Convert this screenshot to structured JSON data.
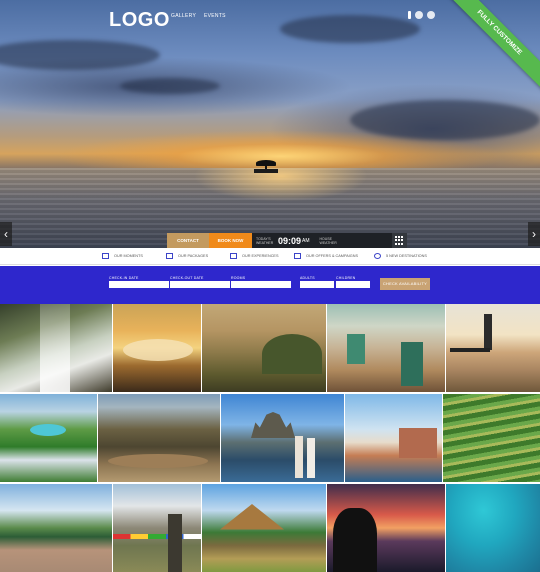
{
  "header": {
    "logo": "LOGO",
    "nav": [
      "GALLERY",
      "EVENTS"
    ]
  },
  "ribbon": "FULLY CUSTOMIZE",
  "booking": {
    "contact_label": "CONTACT",
    "book_label": "BOOK NOW",
    "today_label": "TODAY'S WEATHER",
    "time": "09:09",
    "ampm": "AM",
    "weather_label": "HOUSE WEATHER"
  },
  "features": [
    "OUR MOMENTS",
    "OUR PACKAGES",
    "OUR EXPERIENCES",
    "OUR OFFERS & CAMPAIGNS",
    "5 NEW DESTINATIONS"
  ],
  "search": {
    "checkin_label": "CHECK-IN DATE",
    "checkout_label": "CHECK-OUT DATE",
    "rooms_label": "ROOMS",
    "adults_label": "ADULTS",
    "children_label": "CHILDREN",
    "button_label": "CHECK AVAILABILITY"
  },
  "colors": {
    "accent_orange": "#f08a1a",
    "accent_gold": "#c39a5f",
    "search_bar_blue": "#2e27cc",
    "ribbon_green": "#57b94e"
  },
  "icons": [
    "user-icon",
    "globe-icon",
    "grid-menu-icon",
    "chevron-left-icon",
    "chevron-right-icon"
  ]
}
